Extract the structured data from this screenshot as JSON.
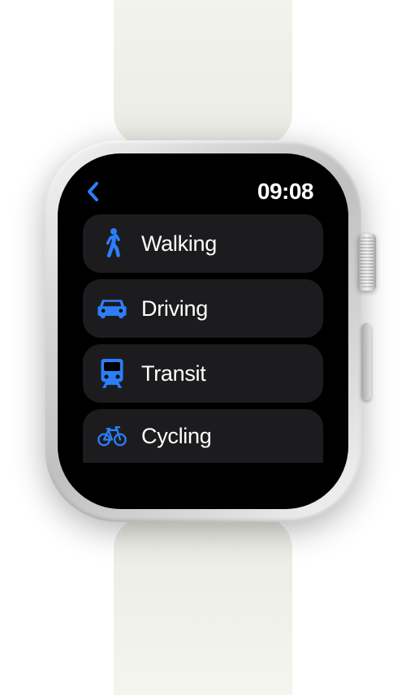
{
  "status_bar": {
    "time": "09:08"
  },
  "accent_color": "#2c7ef6",
  "list": {
    "items": [
      {
        "label": "Walking",
        "icon": "walking-icon"
      },
      {
        "label": "Driving",
        "icon": "car-icon"
      },
      {
        "label": "Transit",
        "icon": "train-icon"
      },
      {
        "label": "Cycling",
        "icon": "bicycle-icon"
      }
    ]
  }
}
